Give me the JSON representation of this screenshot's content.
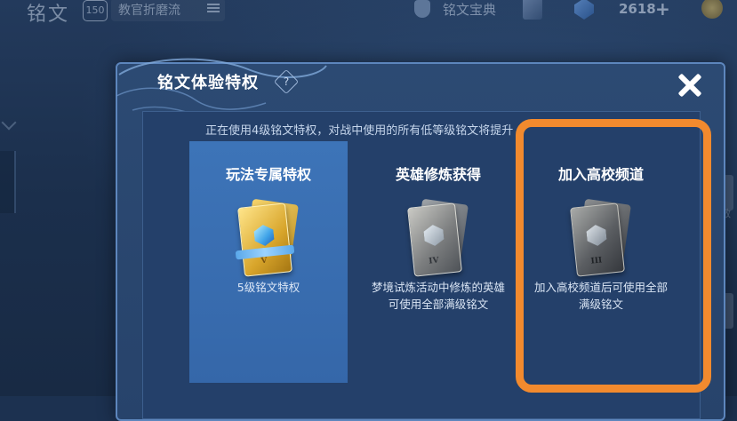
{
  "topbar": {
    "page_title": "铭文",
    "level": "150",
    "preset_name": "教官折磨流",
    "codex_label": "铭文宝典",
    "currency_amount": "2618",
    "plus": "+"
  },
  "background": {
    "right_label": "打散"
  },
  "dialog": {
    "title": "铭文体验特权",
    "help": "?",
    "status_text": "正在使用4级铭文特权，对战中使用的所有低等级铭文将提升",
    "cards": [
      {
        "title": "玩法专属特权",
        "numeral": "V",
        "description": "5级铭文特权",
        "selected": true
      },
      {
        "title": "英雄修炼获得",
        "numeral": "IV",
        "description": "梦境试炼活动中修炼的英雄可使用全部满级铭文",
        "selected": false
      },
      {
        "title": "加入高校频道",
        "numeral": "III",
        "description": "加入高校频道后可使用全部满级铭文",
        "selected": false
      }
    ]
  },
  "colors": {
    "highlight": "#f28a2e",
    "selected_card": "#3d74b8",
    "dialog_bg": "#2c4a73"
  }
}
